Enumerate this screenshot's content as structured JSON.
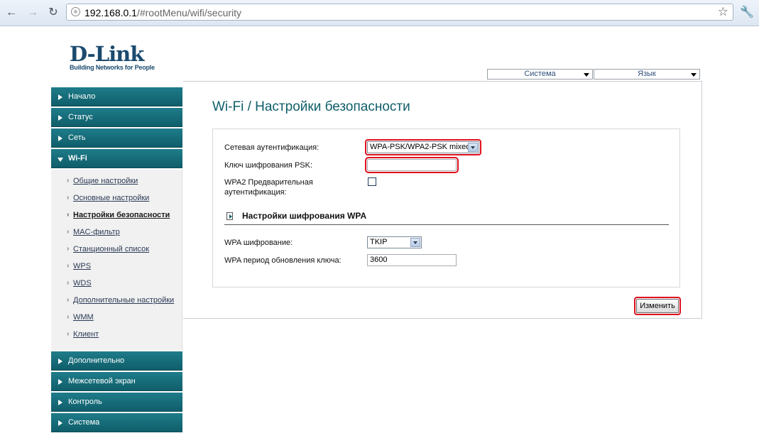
{
  "browser": {
    "url_host": "192.168.0.1",
    "url_path": "/#rootMenu/wifi/security",
    "back_icon": "arrow-left-icon",
    "forward_icon": "arrow-right-icon",
    "reload_icon": "reload-icon",
    "bookmark_icon": "star-icon",
    "menu_icon": "wrench-icon"
  },
  "logo": {
    "brand": "D-Link",
    "tagline": "Building Networks for People"
  },
  "top_menus": {
    "system": "Система",
    "language": "Язык"
  },
  "sidebar": {
    "items_top": [
      {
        "label": "Начало"
      },
      {
        "label": "Статус"
      },
      {
        "label": "Сеть"
      },
      {
        "label": "Wi-Fi"
      }
    ],
    "wifi_subitems": [
      {
        "label": "Общие настройки"
      },
      {
        "label": "Основные настройки"
      },
      {
        "label": "Настройки безопасности"
      },
      {
        "label": "MAC-фильтр"
      },
      {
        "label": "Станционный список"
      },
      {
        "label": "WPS"
      },
      {
        "label": "WDS"
      },
      {
        "label": "Дополнительные настройки"
      },
      {
        "label": "WMM"
      },
      {
        "label": "Клиент"
      }
    ],
    "items_bottom": [
      {
        "label": "Дополнительно"
      },
      {
        "label": "Межсетевой экран"
      },
      {
        "label": "Контроль"
      },
      {
        "label": "Система"
      }
    ]
  },
  "page": {
    "title": "Wi-Fi  / Настройки безопасности"
  },
  "form": {
    "auth_label": "Сетевая аутентификация:",
    "auth_value": "WPA-PSK/WPA2-PSK mixed",
    "psk_label": "Ключ шифрования PSK:",
    "psk_value": "",
    "preauth_label_1": "WPA2 Предварительная",
    "preauth_label_2": "аутентификация:",
    "preauth_checked": false,
    "section_title": "Настройки шифрования WPA",
    "enc_label": "WPA шифрование:",
    "enc_value": "TKIP",
    "rekey_label": "WPA период обновления ключа:",
    "rekey_value": "3600",
    "submit_label": "Изменить"
  },
  "colors": {
    "menu_teal": "#0f5e6a",
    "highlight_red": "#e0101e",
    "brand_blue": "#1b4a6e"
  }
}
